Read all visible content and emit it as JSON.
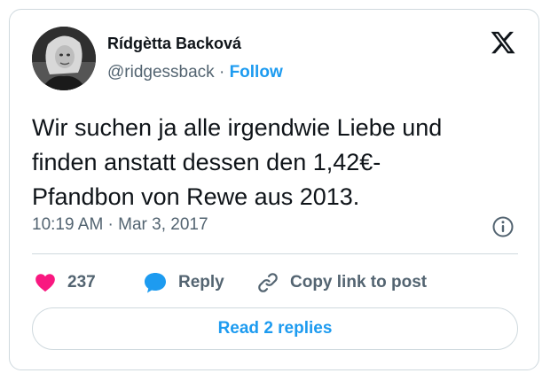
{
  "author": {
    "name": "Rídgètta Backová",
    "handle": "@ridgessback",
    "separator": " · ",
    "follow_label": "Follow"
  },
  "tweet": {
    "text_lines": [
      "Wir suchen ja alle irgendwie Liebe und",
      "finden anstatt dessen den 1,42€-",
      "Pfandbon von Rewe aus 2013."
    ],
    "timestamp": "10:19 AM · Mar 3, 2017"
  },
  "actions": {
    "like_count": "237",
    "reply_label": "Reply",
    "copy_label": "Copy link to post"
  },
  "read_replies_label": "Read 2 replies",
  "colors": {
    "accent": "#1d9bf0",
    "like": "#f91880",
    "text": "#0f1419",
    "muted": "#536471",
    "border": "#cfd9de"
  },
  "icons": [
    "x-logo-icon",
    "info-icon",
    "heart-icon",
    "reply-bubble-icon",
    "link-icon"
  ]
}
